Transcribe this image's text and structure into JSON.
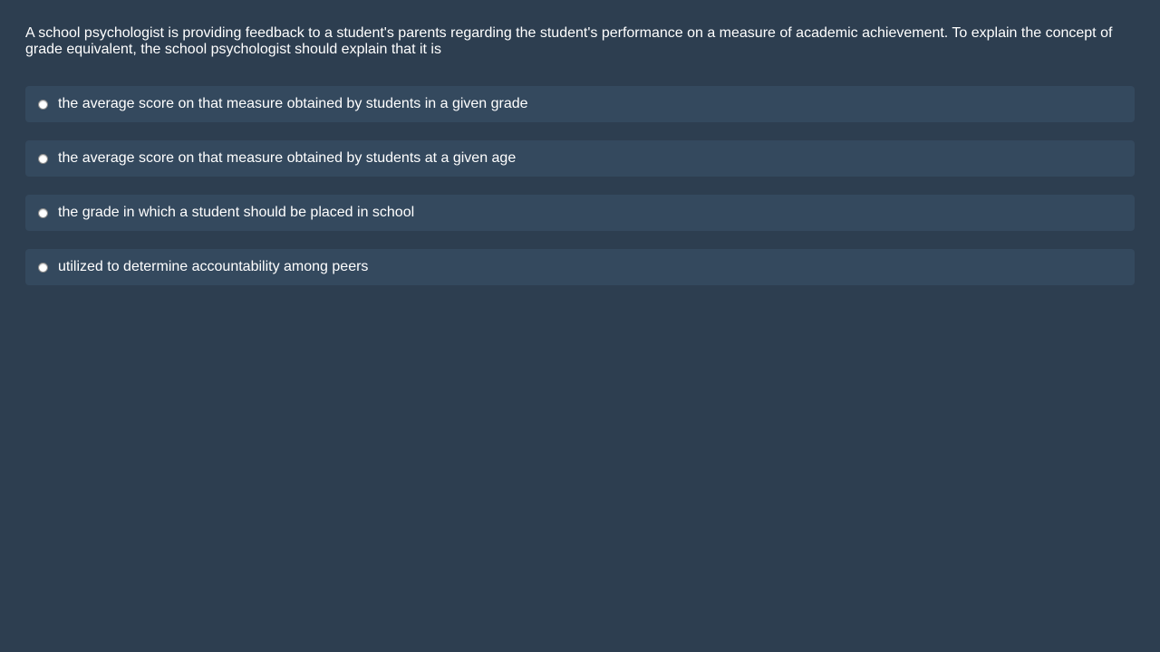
{
  "question": {
    "text": "A school psychologist is providing feedback to a student's parents regarding the student's performance on a measure of academic achievement. To explain the concept of grade equivalent, the school psychologist should explain that it is"
  },
  "options": [
    {
      "label": "the average score on that measure obtained by students in a given grade",
      "selected": false
    },
    {
      "label": "the average score on that measure obtained by students at a given age",
      "selected": false
    },
    {
      "label": "the grade in which a student should be placed in school",
      "selected": false
    },
    {
      "label": "utilized to determine accountability among peers",
      "selected": false
    }
  ],
  "colors": {
    "background": "#2d3e50",
    "option_background": "#34495e",
    "text": "#ffffff"
  }
}
